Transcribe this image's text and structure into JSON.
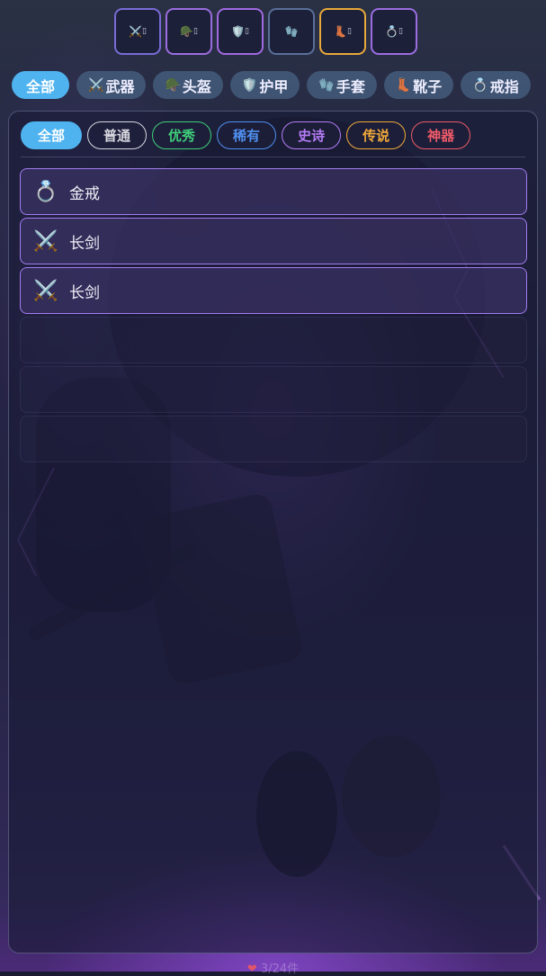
{
  "slots": [
    {
      "name": "weapon",
      "icon": "⚔️",
      "suffix": "▯",
      "border": "#7a6bd6"
    },
    {
      "name": "helmet",
      "icon": "🪖",
      "suffix": "▯",
      "border": "#9b6de0"
    },
    {
      "name": "armor",
      "icon": "🛡️",
      "suffix": "▯",
      "border": "#a06ae0"
    },
    {
      "name": "gloves",
      "icon": "🧤",
      "suffix": "",
      "border": "#5a6f9a"
    },
    {
      "name": "boots",
      "icon": "👢",
      "suffix": "▯",
      "border": "#e8a93a"
    },
    {
      "name": "ring",
      "icon": "💍",
      "suffix": "▯",
      "border": "#9b6de0"
    }
  ],
  "type_tabs": [
    {
      "label": "全部",
      "icon": "",
      "active": true
    },
    {
      "label": "武器",
      "icon": "⚔️",
      "active": false
    },
    {
      "label": "头盔",
      "icon": "🪖",
      "active": false
    },
    {
      "label": "护甲",
      "icon": "🛡️",
      "active": false
    },
    {
      "label": "手套",
      "icon": "🧤",
      "active": false
    },
    {
      "label": "靴子",
      "icon": "👢",
      "active": false
    },
    {
      "label": "戒指",
      "icon": "💍",
      "active": false
    }
  ],
  "rarity_filters": [
    {
      "label": "全部",
      "color": "#4fb3f0",
      "active": true
    },
    {
      "label": "普通",
      "color": "#d7d7df",
      "active": false
    },
    {
      "label": "优秀",
      "color": "#3fd07a",
      "active": false
    },
    {
      "label": "稀有",
      "color": "#4f8ff0",
      "active": false
    },
    {
      "label": "史诗",
      "color": "#b47cf5",
      "active": false
    },
    {
      "label": "传说",
      "color": "#f0a93a",
      "active": false
    },
    {
      "label": "神器",
      "color": "#ee5a68",
      "active": false
    }
  ],
  "items": [
    {
      "name": "金戒",
      "icon": "💍"
    },
    {
      "name": "长剑",
      "icon": "⚔️"
    },
    {
      "name": "长剑",
      "icon": "⚔️"
    }
  ],
  "empty_rows": 3,
  "footer": {
    "icon": "❤",
    "count_text": "3/24件"
  },
  "colors": {
    "accent": "#4fb3f0",
    "epic_border": "#a37cf0"
  }
}
